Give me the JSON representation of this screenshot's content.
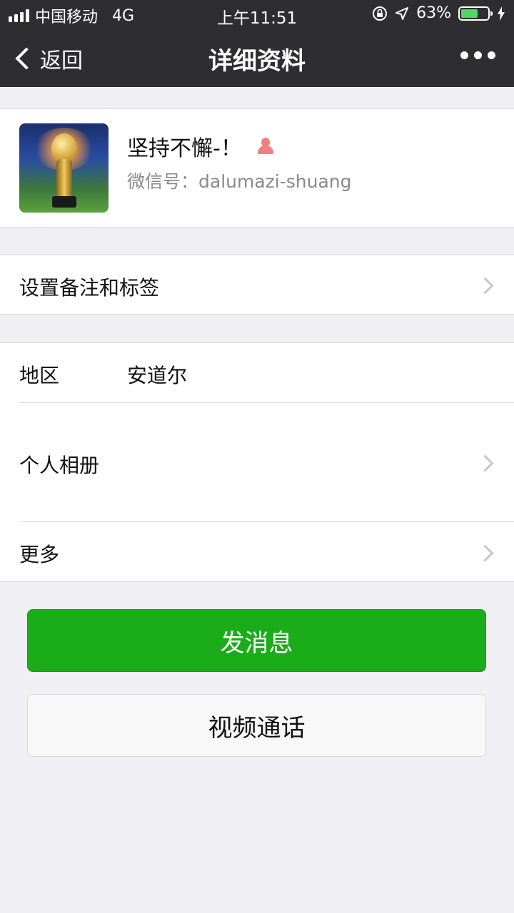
{
  "status_bar": {
    "carrier": "中国移动",
    "network": "4G",
    "time": "上午11:51",
    "battery_percent": "63%",
    "battery_level": 0.63
  },
  "nav": {
    "back_label": "返回",
    "title": "详细资料"
  },
  "profile": {
    "name": "坚持不懈-！",
    "wechat_id": "微信号：dalumazi-shuang",
    "gender_icon": "female-icon"
  },
  "remark_row": {
    "label": "设置备注和标签"
  },
  "details": {
    "region_label": "地区",
    "region_value": "安道尔",
    "album_label": "个人相册",
    "more_label": "更多"
  },
  "actions": {
    "message_button": "发消息",
    "video_call_button": "视频通话"
  },
  "colors": {
    "nav_bg": "#2e2e30",
    "primary_green": "#1aad19",
    "page_bg": "#efeff4"
  }
}
